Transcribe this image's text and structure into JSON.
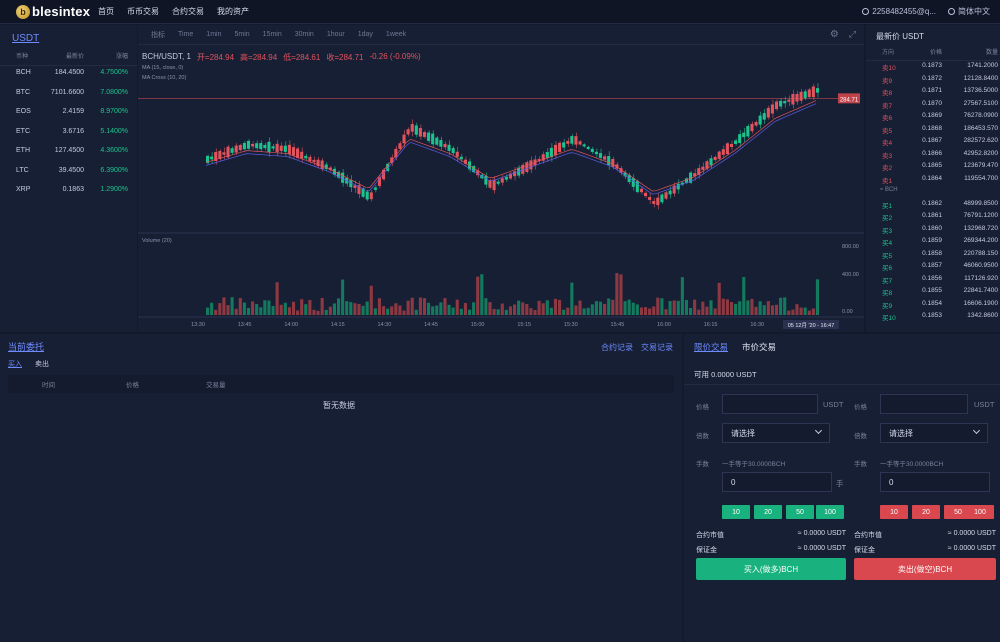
{
  "header": {
    "logo_letter": "b",
    "brand": "blesintex",
    "nav": [
      "首页",
      "币币交易",
      "合约交易",
      "我的资产"
    ],
    "user": "2258482455@q...",
    "language": "简体中文"
  },
  "market": {
    "tab": "USDT",
    "columns": [
      "币种",
      "最新价",
      "涨幅"
    ],
    "rows": [
      {
        "coin": "BCH",
        "price": "184.4500",
        "change": "4.7500%"
      },
      {
        "coin": "BTC",
        "price": "7101.6600",
        "change": "7.0800%"
      },
      {
        "coin": "EOS",
        "price": "2.4159",
        "change": "8.9700%"
      },
      {
        "coin": "ETC",
        "price": "3.6716",
        "change": "5.1400%"
      },
      {
        "coin": "ETH",
        "price": "127.4500",
        "change": "4.3600%"
      },
      {
        "coin": "LTC",
        "price": "39.4500",
        "change": "6.3900%"
      },
      {
        "coin": "XRP",
        "price": "0.1863",
        "change": "1.2900%"
      }
    ]
  },
  "chart": {
    "toolbar": [
      "指标",
      "Time",
      "1min",
      "5min",
      "15min",
      "30min",
      "1hour",
      "1day",
      "1week"
    ],
    "symbol": "BCH/USDT, 1",
    "open": "开=284.94",
    "high": "高=284.94",
    "low": "低=284.61",
    "close": "收=284.71",
    "delta": "-0.26 (-0.09%)",
    "indicator1": "MA (15, close, 0)",
    "indicator2": "MA Cross (10, 20)",
    "volume_label": "Volume (20)",
    "price_tag": "284.71",
    "vol_ticks": [
      "800.00",
      "400.00",
      "0.00"
    ],
    "time_ticks": [
      "13:30",
      "13:45",
      "14:00",
      "14:15",
      "14:30",
      "14:45",
      "15:00",
      "15:15",
      "15:30",
      "15:45",
      "16:00",
      "16:15",
      "16:30"
    ],
    "crosshair_time": "05 12月 '20 - 16:47"
  },
  "chart_data": {
    "type": "candlestick",
    "title": "BCH/USDT, 1",
    "last_price": 284.71,
    "volume_axis": [
      0,
      800
    ],
    "x": [
      "13:30",
      "13:45",
      "14:00",
      "14:15",
      "14:30",
      "14:45",
      "15:00",
      "15:15",
      "15:30",
      "15:45",
      "16:00",
      "16:15",
      "16:30"
    ],
    "close_path": [
      0.52,
      0.42,
      0.45,
      0.58,
      0.78,
      0.3,
      0.45,
      0.7,
      0.55,
      0.38,
      0.55,
      0.82,
      0.62,
      0.4,
      0.15,
      0.05
    ],
    "ma_path": [
      0.54,
      0.46,
      0.48,
      0.58,
      0.72,
      0.38,
      0.48,
      0.65,
      0.55,
      0.45,
      0.55,
      0.74,
      0.64,
      0.46,
      0.24,
      0.12
    ]
  },
  "orderbook": {
    "title": "最新价 USDT",
    "columns": [
      "方向",
      "价格",
      "数量"
    ],
    "asks": [
      {
        "side": "卖10",
        "price": "0.1873",
        "qty": "1741.2000"
      },
      {
        "side": "卖9",
        "price": "0.1872",
        "qty": "12128.8400"
      },
      {
        "side": "卖8",
        "price": "0.1871",
        "qty": "13736.5000"
      },
      {
        "side": "卖7",
        "price": "0.1870",
        "qty": "27567.5100"
      },
      {
        "side": "卖6",
        "price": "0.1869",
        "qty": "76278.0900"
      },
      {
        "side": "卖5",
        "price": "0.1868",
        "qty": "186453.570"
      },
      {
        "side": "卖4",
        "price": "0.1867",
        "qty": "282572.620"
      },
      {
        "side": "卖3",
        "price": "0.1866",
        "qty": "42952.8200"
      },
      {
        "side": "卖2",
        "price": "0.1865",
        "qty": "123679.470"
      },
      {
        "side": "卖1",
        "price": "0.1864",
        "qty": "119554.700"
      }
    ],
    "mid": "≈ BCH",
    "bids": [
      {
        "side": "买1",
        "price": "0.1862",
        "qty": "48999.8500"
      },
      {
        "side": "买2",
        "price": "0.1861",
        "qty": "76791.1200"
      },
      {
        "side": "买3",
        "price": "0.1860",
        "qty": "132968.720"
      },
      {
        "side": "买4",
        "price": "0.1859",
        "qty": "269344.200"
      },
      {
        "side": "买5",
        "price": "0.1858",
        "qty": "220788.150"
      },
      {
        "side": "买6",
        "price": "0.1857",
        "qty": "46060.9500"
      },
      {
        "side": "买7",
        "price": "0.1856",
        "qty": "117126.920"
      },
      {
        "side": "买8",
        "price": "0.1855",
        "qty": "22841.7400"
      },
      {
        "side": "买9",
        "price": "0.1854",
        "qty": "16606.1900"
      },
      {
        "side": "买10",
        "price": "0.1853",
        "qty": "1342.8600"
      }
    ]
  },
  "orders": {
    "title": "当前委托",
    "links": [
      "合约记录",
      "交易记录"
    ],
    "tabs": [
      "买入",
      "卖出"
    ],
    "columns": [
      "时间",
      "价格",
      "交易量"
    ],
    "empty": "暂无数据"
  },
  "trade": {
    "tabs": [
      "限价交易",
      "市价交易"
    ],
    "available": "可用 0.0000 USDT",
    "price_label": "价格",
    "price_unit": "USDT",
    "leverage_label": "倍数",
    "select_placeholder": "请选择",
    "lots_label": "手数",
    "lots_hint": "一手等于30.0000BCH",
    "lots_value": "0",
    "lots_unit": "手",
    "quick": [
      "10",
      "20",
      "50",
      "100"
    ],
    "contract_value_label": "合约市值",
    "contract_value": "≈ 0.0000 USDT",
    "margin_label": "保证金",
    "margin": "≈ 0.0000 USDT",
    "buy_label": "买入(做多)BCH",
    "sell_label": "卖出(做空)BCH"
  }
}
